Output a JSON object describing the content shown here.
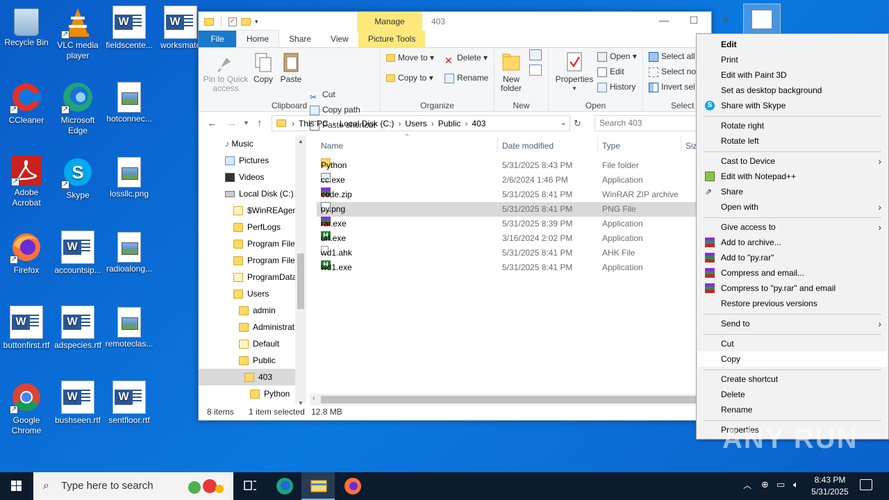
{
  "desktop": {
    "icons": [
      {
        "label": "Recycle Bin"
      },
      {
        "label": "VLC media player"
      },
      {
        "label": "fieldscente..."
      },
      {
        "label": "worksmate"
      },
      {
        "label": "CCleaner"
      },
      {
        "label": "Microsoft Edge"
      },
      {
        "label": "hotconnec..."
      },
      {
        "label": "Adobe Acrobat"
      },
      {
        "label": "Skype"
      },
      {
        "label": "lossllc.png"
      },
      {
        "label": "Firefox"
      },
      {
        "label": "accountsip..."
      },
      {
        "label": "radioalong..."
      },
      {
        "label": "buttonfirst.rtf"
      },
      {
        "label": "adspecies.rtf"
      },
      {
        "label": "remoteclas..."
      },
      {
        "label": "Google Chrome"
      },
      {
        "label": "bushseen.rtf"
      },
      {
        "label": "sentfloor.rtf"
      }
    ]
  },
  "explorer": {
    "title": "403",
    "manage_tab": "Manage",
    "tabs": [
      "File",
      "Home",
      "Share",
      "View",
      "Picture Tools"
    ],
    "ribbon": {
      "clipboard": {
        "label": "Clipboard",
        "pin": "Pin to Quick access",
        "copy": "Copy",
        "paste": "Paste",
        "cut": "Cut",
        "copy_path": "Copy path",
        "paste_shortcut": "Paste shortcut"
      },
      "organize": {
        "label": "Organize",
        "move_to": "Move to",
        "copy_to": "Copy to",
        "delete": "Delete",
        "rename": "Rename"
      },
      "new": {
        "label": "New",
        "new_folder": "New folder"
      },
      "open": {
        "label": "Open",
        "properties": "Properties",
        "open": "Open",
        "edit": "Edit",
        "history": "History"
      },
      "select": {
        "label": "Select",
        "select_all": "Select all",
        "select_none": "Select no",
        "invert": "Invert sel"
      }
    },
    "address": {
      "crumbs": [
        "This PC",
        "Local Disk (C:)",
        "Users",
        "Public",
        "403"
      ],
      "search_placeholder": "Search 403"
    },
    "nav": [
      {
        "label": "Music"
      },
      {
        "label": "Pictures"
      },
      {
        "label": "Videos"
      },
      {
        "label": "Local Disk (C:)"
      },
      {
        "label": "$WinREAgent"
      },
      {
        "label": "PerfLogs"
      },
      {
        "label": "Program Files"
      },
      {
        "label": "Program Files"
      },
      {
        "label": "ProgramData"
      },
      {
        "label": "Users"
      },
      {
        "label": "admin"
      },
      {
        "label": "Administrat"
      },
      {
        "label": "Default"
      },
      {
        "label": "Public"
      },
      {
        "label": "403"
      },
      {
        "label": "Python"
      }
    ],
    "columns": {
      "name": "Name",
      "date": "Date modified",
      "type": "Type",
      "size": "Size"
    },
    "files": [
      {
        "name": "Python",
        "date": "5/31/2025 8:43 PM",
        "type": "File folder",
        "icon": "folder-icon"
      },
      {
        "name": "cc.exe",
        "date": "2/6/2024 1:46 PM",
        "type": "Application",
        "icon": "exe-icon"
      },
      {
        "name": "code.zip",
        "date": "5/31/2025 8:41 PM",
        "type": "WinRAR ZIP archive",
        "icon": "winrar-icon"
      },
      {
        "name": "py.png",
        "date": "5/31/2025 8:41 PM",
        "type": "PNG File",
        "icon": "png-file-icon"
      },
      {
        "name": "rar.exe",
        "date": "5/31/2025 8:39 PM",
        "type": "Application",
        "icon": "winrar-icon"
      },
      {
        "name": "url.exe",
        "date": "3/16/2024 2:02 PM",
        "type": "Application",
        "icon": "autohotkey-icon"
      },
      {
        "name": "wd1.ahk",
        "date": "5/31/2025 8:41 PM",
        "type": "AHK File",
        "icon": "text-file-icon"
      },
      {
        "name": "wd1.exe",
        "date": "5/31/2025 8:41 PM",
        "type": "Application",
        "icon": "autohotkey-icon"
      }
    ],
    "status": {
      "count": "8 items",
      "selected": "1 item selected",
      "size": "12.8 MB"
    }
  },
  "context_menu": {
    "items": [
      "Edit",
      "Print",
      "Edit with Paint 3D",
      "Set as desktop background",
      "Share with Skype",
      "Rotate right",
      "Rotate left",
      "Cast to Device",
      "Edit with Notepad++",
      "Share",
      "Open with",
      "Give access to",
      "Add to archive...",
      "Add to \"py.rar\"",
      "Compress and email...",
      "Compress to \"py.rar\" and email",
      "Restore previous versions",
      "Send to",
      "Cut",
      "Copy",
      "Create shortcut",
      "Delete",
      "Rename",
      "Properties"
    ]
  },
  "watermark": "ANY RUN",
  "taskbar": {
    "search_placeholder": "Type here to search",
    "time": "8:43 PM",
    "date": "5/31/2025"
  }
}
